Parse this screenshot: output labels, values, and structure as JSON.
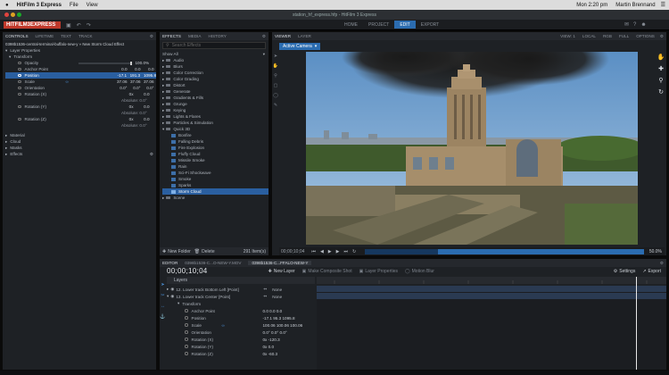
{
  "mac_menu": {
    "app": "HitFilm 3 Express",
    "file": "File",
    "view": "View",
    "time": "Mon 2:20 pm",
    "user": "Martin Brennand"
  },
  "window_title": "station_hf_express.hfp - HitFilm 3 Express",
  "app_logo": "HITFILM3EXPRESS",
  "nav": {
    "home": "HOME",
    "project": "PROJECT",
    "edit": "EDIT",
    "export": "EXPORT"
  },
  "controls": {
    "tabs": [
      "CONTROLS",
      "LIFETIME",
      "TEXT",
      "TRACK"
    ],
    "effect_path": "0398b1536-central-terminal-buffalo-new-y » New Storm Cloud Effect",
    "layer_properties": "Layer Properties",
    "transform": "Transform",
    "props": [
      {
        "name": "Opacity",
        "v1": "100.0%",
        "v2": "",
        "v3": ""
      },
      {
        "name": "Anchor Point",
        "v1": "0.0",
        "v2": "0.0",
        "v3": "0.0"
      },
      {
        "name": "Position",
        "v1": "-17.1",
        "v2": "191.3",
        "v3": "1095.8"
      },
      {
        "name": "Scale",
        "v1": "37.06",
        "v2": "37.06",
        "v3": "37.06"
      },
      {
        "name": "Orientation",
        "v1": "0.0°",
        "v2": "0.0°",
        "v3": "0.0°"
      }
    ],
    "rotations": [
      {
        "name": "Rotation (X)",
        "turns": "0x",
        "angle": "0.0",
        "abs": "Absolute: 0.0°"
      },
      {
        "name": "Rotation (Y)",
        "turns": "0x",
        "angle": "0.0",
        "abs": "Absolute: 0.0°"
      },
      {
        "name": "Rotation (Z)",
        "turns": "0x",
        "angle": "0.0",
        "abs": "Absolute: 0.0°"
      }
    ],
    "sections": [
      "Material",
      "Cloud",
      "Masks",
      "Effects"
    ]
  },
  "effects": {
    "tabs": [
      "EFFECTS",
      "MEDIA",
      "HISTORY"
    ],
    "search_placeholder": "Search Effects",
    "show_all": "Show All",
    "categories": [
      "Audio",
      "Blurs",
      "Color Correction",
      "Color Grading",
      "Distort",
      "Generate",
      "Gradients & Fills",
      "Grunge",
      "Keying",
      "Lights & Flares",
      "Particles & Simulation",
      "Quick 3D"
    ],
    "quick3d": [
      "Bonfire",
      "Falling Debris",
      "Fire Explosion",
      "Fluffy Cloud",
      "Missile Smoke",
      "Rain",
      "Sci-Fi Shockwave",
      "Smoke",
      "Sparks",
      "Storm Cloud"
    ],
    "last": "Scene",
    "new_folder": "New Folder",
    "delete": "Delete",
    "count": "291 Item(s)"
  },
  "viewer": {
    "tabs": [
      "VIEWER",
      "LAYER"
    ],
    "active_camera": "Active Camera",
    "options": [
      "VIEW: 1",
      "LOCAL",
      "RGB",
      "FULL",
      "OPTIONS"
    ],
    "time_start": "00;00;10;04",
    "zoom": "50.0%",
    "fit": "Fit"
  },
  "editor": {
    "tabs": [
      "EDITOR",
      "0398b1536-C...O-NEW-Y.MOV",
      "0398b1536-C...FFALO-NEW-Y"
    ],
    "timecode": "00;00;10;04",
    "new_layer": "New Layer",
    "tools": [
      "Make Composite Shot",
      "Layer Properties",
      "Motion Blur"
    ],
    "settings": "Settings",
    "export": "Export",
    "layers_label": "Layers",
    "rows": [
      {
        "label": "12. Lower track Bottom Left [Point]",
        "parent": "None"
      },
      {
        "label": "13. Lower track Center [Point]",
        "parent": "None"
      }
    ],
    "transform": "Transform",
    "props": [
      {
        "name": "Anchor Point",
        "v": "0.0   0.0   0.0"
      },
      {
        "name": "Position",
        "v": "-17.1   95.3   1095.8"
      },
      {
        "name": "Scale",
        "v": "100.06   100.06   100.06"
      },
      {
        "name": "Orientation",
        "v": "0.0°   0.0°   0.0°"
      },
      {
        "name": "Rotation (X)",
        "v": "0x   -120.3"
      },
      {
        "name": "Rotation (Y)",
        "v": "0x   0.0"
      },
      {
        "name": "Rotation (Z)",
        "v": "0x   -60.3"
      }
    ]
  },
  "colors": {
    "accent": "#2b6cb0",
    "logo": "#c0392b",
    "panel": "#1e2125"
  }
}
